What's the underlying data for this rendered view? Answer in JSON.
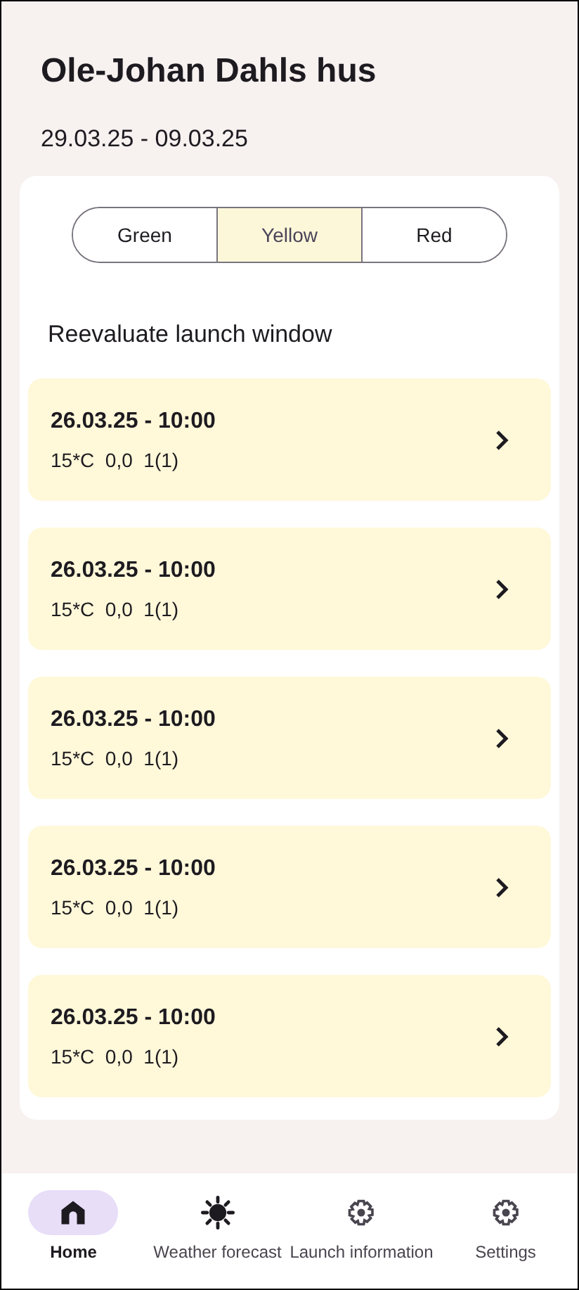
{
  "title": "Ole-Johan Dahls hus",
  "date_range": "29.03.25 - 09.03.25",
  "segments": [
    {
      "label": "Green",
      "selected": false
    },
    {
      "label": "Yellow",
      "selected": true
    },
    {
      "label": "Red",
      "selected": false
    }
  ],
  "section_title": "Reevaluate launch window",
  "windows": [
    {
      "datetime": "26.03.25 - 10:00",
      "details": "15*C  0,0  1(1)"
    },
    {
      "datetime": "26.03.25 - 10:00",
      "details": "15*C  0,0  1(1)"
    },
    {
      "datetime": "26.03.25 - 10:00",
      "details": "15*C  0,0  1(1)"
    },
    {
      "datetime": "26.03.25 - 10:00",
      "details": "15*C  0,0  1(1)"
    },
    {
      "datetime": "26.03.25 - 10:00",
      "details": "15*C  0,0  1(1)"
    }
  ],
  "nav": [
    {
      "label": "Home",
      "kind": "home",
      "selected": true
    },
    {
      "label": "Weather forecast",
      "kind": "sun",
      "selected": false
    },
    {
      "label": "Launch information",
      "kind": "gear",
      "selected": false
    },
    {
      "label": "Settings",
      "kind": "gear",
      "selected": false
    }
  ]
}
